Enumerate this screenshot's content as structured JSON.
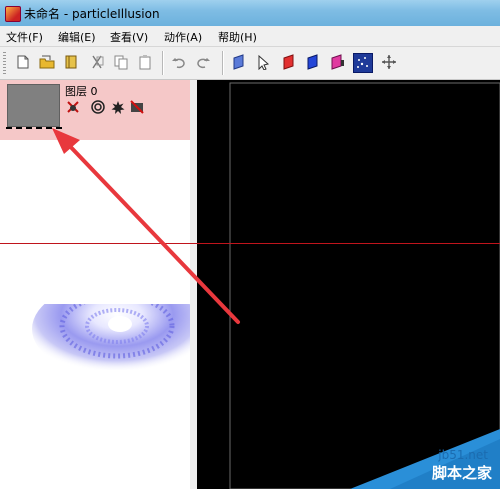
{
  "window": {
    "title": "未命名 - particleIllusion"
  },
  "menu": [
    "文件(F)",
    "编辑(E)",
    "查看(V)",
    "动作(A)",
    "帮助(H)"
  ],
  "toolbar": {
    "icons": [
      "new-file-icon",
      "open-folder-icon",
      "library-icon",
      "cut-icon",
      "copy-icon",
      "paste-icon",
      "undo-icon",
      "redo-icon",
      "layer-icon",
      "select-arrow-icon",
      "red-emitter-icon",
      "blue-deflector-icon",
      "pink-blocker-icon",
      "particle-emitter-icon",
      "move-icon"
    ],
    "selected": "particle-emitter-icon"
  },
  "layer": {
    "name": "图层",
    "index": "0",
    "icons": [
      "hide-x-icon",
      "target-icon",
      "burst-icon",
      "crossed-box-icon"
    ]
  },
  "colors": {
    "layer_bg": "#f5c8c8",
    "canvas": "#000000",
    "guide_line": "#c0141c",
    "arrow": "#e8383d",
    "selected_tool": "#1f3a99"
  },
  "watermark": {
    "url": "jb51.net",
    "name": "脚本之家"
  }
}
